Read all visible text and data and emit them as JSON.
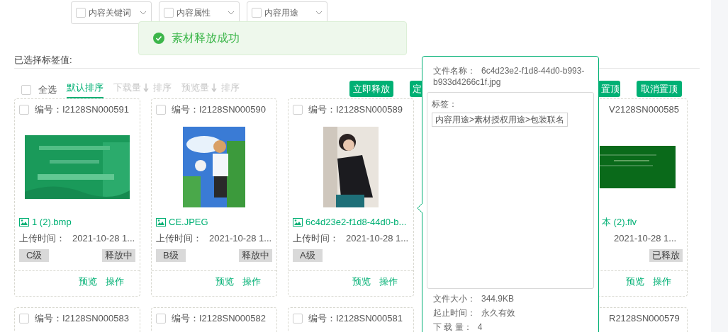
{
  "filters": [
    {
      "label": "内容关键词",
      "checked": false
    },
    {
      "label": "内容属性",
      "checked": false
    },
    {
      "label": "内容用途",
      "checked": false
    }
  ],
  "toast": {
    "text": "素材释放成功"
  },
  "selected_tags_label": "已选择标签值:",
  "toolbar": {
    "select_all": {
      "label": "全选",
      "checked": false
    },
    "sort_tabs": [
      {
        "label": "默认排序",
        "selected": true
      },
      {
        "label": "下载量",
        "suffix": "排序",
        "selected": false
      },
      {
        "label": "预览量",
        "suffix": "排序",
        "selected": false
      }
    ],
    "buttons": [
      {
        "label": "立即释放",
        "kind": "full"
      },
      {
        "label": "定",
        "kind": "cut_right"
      },
      {
        "label": "置顶",
        "kind": "cut_left"
      },
      {
        "label": "取消置顶",
        "kind": "full_wide"
      }
    ]
  },
  "cards": [
    {
      "kind": "full",
      "checked": false,
      "id_label": "编号：",
      "id": "I2128SN000591",
      "picture": {
        "kind": "picture"
      },
      "file_name": "1 (2).bmp",
      "upload_label": "上传时间：",
      "upload_time": "2021-10-28 1...",
      "grade": "C级",
      "status": "释放中",
      "actions": [
        "预览",
        "操作"
      ]
    },
    {
      "kind": "full",
      "checked": false,
      "id_label": "编号：",
      "id": "I2128SN000590",
      "picture": {
        "kind": "picture"
      },
      "file_name": "CE.JPEG",
      "upload_label": "上传时间：",
      "upload_time": "2021-10-28 1...",
      "grade": "B级",
      "status": "释放中",
      "actions": [
        "预览",
        "操作"
      ]
    },
    {
      "kind": "full",
      "checked": false,
      "id_label": "编号：",
      "id": "I2128SN000589",
      "picture": {
        "kind": "picture"
      },
      "file_name": "6c4d23e2-f1d8-44d0-b...",
      "upload_label": "上传时间：",
      "upload_time": "2021-10-28 1...",
      "grade": "A级",
      "actions": [
        "预览",
        "操作"
      ]
    },
    {
      "kind": "partial",
      "id": "V2128SN000585",
      "picture": {
        "kind": "picture"
      },
      "file_name": "本 (2).flv",
      "upload_time": "2021-10-28 1...",
      "status": "已释放",
      "actions": [
        "预览",
        "操作"
      ]
    },
    {
      "kind": "full",
      "checked": false,
      "id_label": "编号：",
      "id": "I2128SN000583"
    },
    {
      "kind": "full",
      "checked": false,
      "id_label": "编号：",
      "id": "I2128SN000582"
    },
    {
      "kind": "full",
      "checked": false,
      "id_label": "编号：",
      "id": "I2128SN000581"
    },
    {
      "kind": "partial",
      "id": "R2128SN000579"
    }
  ],
  "popover": {
    "name_label": "文件名称：",
    "name": "6c4d23e2-f1d8-44d0-b993-b933d4266c1f.jpg",
    "tags_label": "标签：",
    "tags": [
      "内容用途>素材授权用途>包装联名"
    ],
    "details": [
      {
        "label": "文件大小：",
        "value": "344.9KB"
      },
      {
        "label": "起止时间：",
        "value": "永久有效"
      },
      {
        "label": "下 载 量：",
        "value": "4"
      }
    ]
  }
}
